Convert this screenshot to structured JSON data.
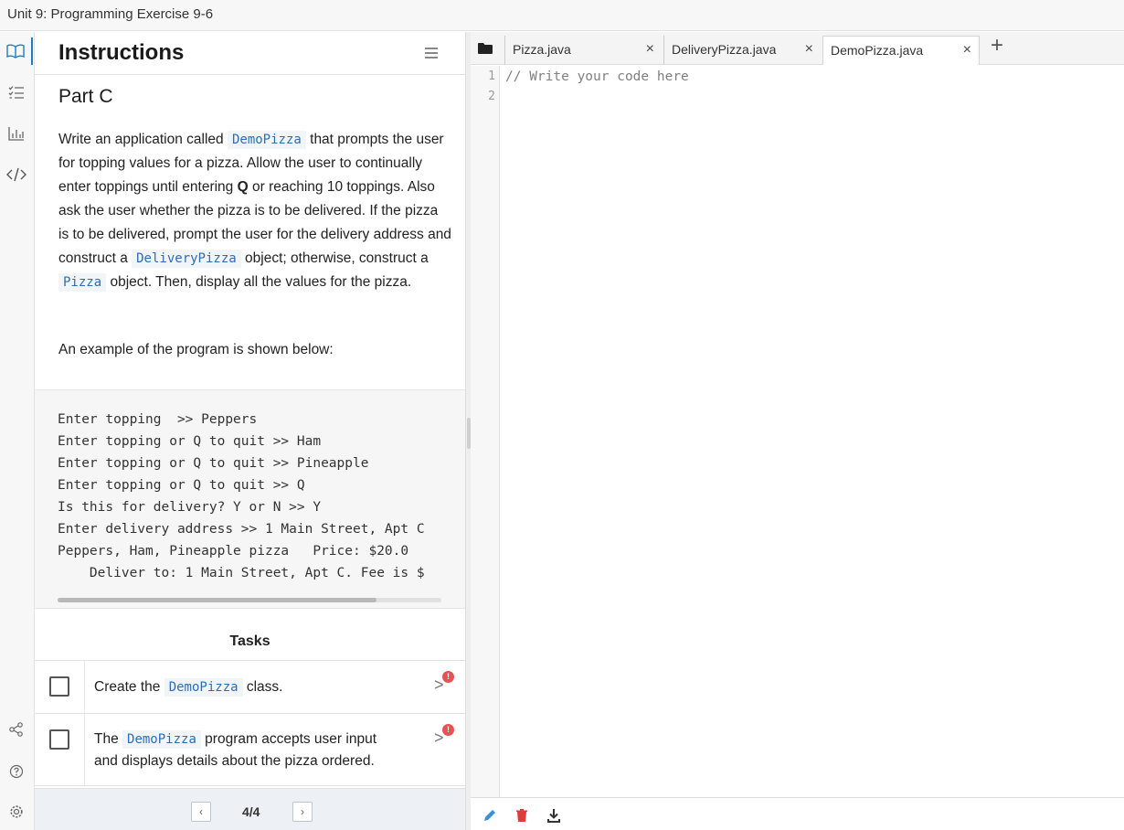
{
  "window": {
    "title": "Unit 9: Programming Exercise 9-6"
  },
  "rail": {
    "icons": [
      "book-icon",
      "checklist-icon",
      "chart-icon",
      "code-icon",
      "share-icon",
      "help-icon",
      "settings-icon"
    ]
  },
  "instructions": {
    "header": "Instructions",
    "part": "Part C",
    "para": {
      "t1": "Write an application called ",
      "c1": "DemoPizza",
      "t2": " that prompts the user for topping values for a pizza. Allow the user to continually enter toppings until entering ",
      "b1": "Q",
      "t3": " or reaching 10 toppings. Also ask the user whether the pizza is to be delivered. If the pizza is to be delivered, prompt the user for the delivery address and construct a ",
      "c2": "DeliveryPizza",
      "t4": " object; otherwise, construct a ",
      "c3": "Pizza",
      "t5": " object. Then, display all the values for the pizza."
    },
    "example_intro": "An example of the program is shown below:",
    "example_lines": [
      "Enter topping  >> Peppers",
      "Enter topping or Q to quit >> Ham",
      "Enter topping or Q to quit >> Pineapple",
      "Enter topping or Q to quit >> Q",
      "Is this for delivery? Y or N >> Y",
      "Enter delivery address >> 1 Main Street, Apt C",
      "Peppers, Ham, Pineapple pizza   Price: $20.0",
      "    Deliver to: 1 Main Street, Apt C. Fee is $"
    ]
  },
  "tasks": {
    "title": "Tasks",
    "items": [
      {
        "pre": "Create the ",
        "code": "DemoPizza",
        "post": " class.",
        "post2": "",
        "badge": "!"
      },
      {
        "pre": "The ",
        "code": "DemoPizza",
        "post": " program accepts user input",
        "post2": "and displays details about the pizza ordered.",
        "badge": "!"
      }
    ]
  },
  "pager": {
    "prev": "‹",
    "next": "›",
    "count": "4/4"
  },
  "editor": {
    "tabs": [
      {
        "label": "Pizza.java",
        "close": "×"
      },
      {
        "label": "DeliveryPizza.java",
        "close": "×"
      },
      {
        "label": "DemoPizza.java",
        "close": "×"
      }
    ],
    "add_tab": "+",
    "line_numbers": [
      "1",
      "2"
    ],
    "code_lines": [
      "// Write your code here",
      ""
    ]
  }
}
